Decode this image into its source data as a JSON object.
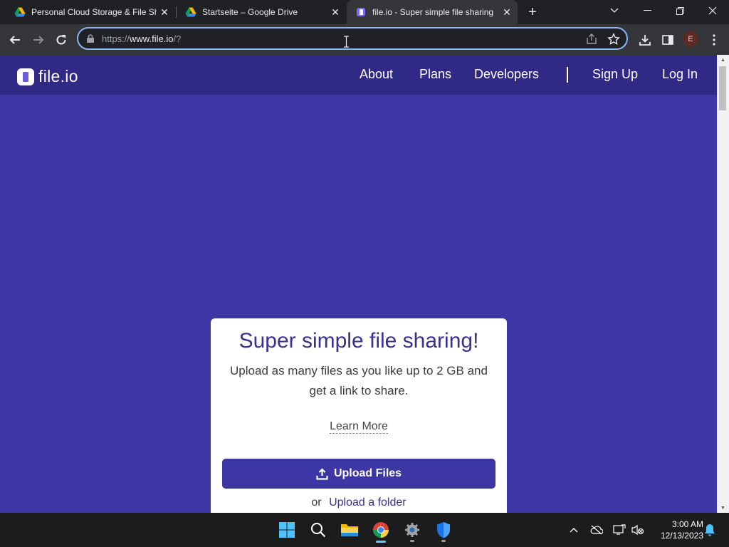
{
  "browser": {
    "tabs": [
      {
        "title": "Personal Cloud Storage & File Sh",
        "favicon": "google-drive-icon",
        "active": false
      },
      {
        "title": "Startseite – Google Drive",
        "favicon": "google-drive-icon",
        "active": false
      },
      {
        "title": "file.io - Super simple file sharing",
        "favicon": "fileio-icon",
        "active": true
      }
    ],
    "address": {
      "scheme": "https://",
      "host": "www.file.io",
      "path": "/?"
    },
    "profile_initial": "E"
  },
  "site": {
    "logo_text": "file.io",
    "nav": {
      "about": "About",
      "plans": "Plans",
      "developers": "Developers",
      "sign_up": "Sign Up",
      "log_in": "Log In"
    },
    "card": {
      "heading": "Super simple file sharing!",
      "subtitle": "Upload as many files as you like up to 2 GB and get a link to share.",
      "learn_more": "Learn More",
      "upload_button": "Upload Files",
      "or_text": "or",
      "upload_folder": "Upload a folder"
    }
  },
  "taskbar": {
    "time": "3:00 AM",
    "date": "12/13/2023"
  },
  "colors": {
    "page_bg": "#3c37a4",
    "nav_bg": "#302a86",
    "heading": "#38328f",
    "button_bg": "#3c37a4"
  }
}
